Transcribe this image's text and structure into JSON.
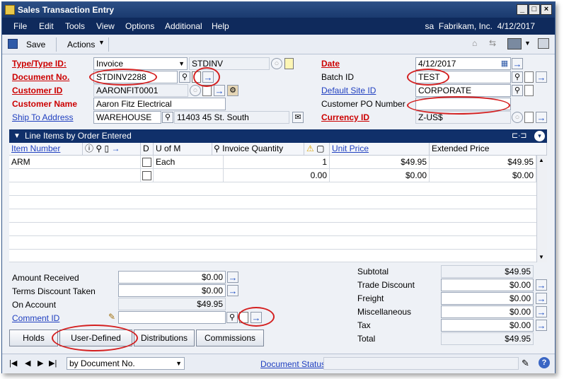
{
  "window": {
    "title": "Sales Transaction Entry"
  },
  "menu": {
    "items": [
      "File",
      "Edit",
      "Tools",
      "View",
      "Options",
      "Additional",
      "Help"
    ],
    "user": "sa",
    "company": "Fabrikam, Inc.",
    "date": "4/12/2017"
  },
  "toolbar": {
    "save": "Save",
    "actions": "Actions"
  },
  "header": {
    "type_label": "Type/Type ID:",
    "type_value": "Invoice",
    "type_id": "STDINV",
    "doc_label": "Document No.",
    "doc_value": "STDINV2288",
    "cust_id_label": "Customer ID",
    "cust_id_value": "AARONFIT0001",
    "cust_name_label": "Customer Name",
    "cust_name_value": "Aaron Fitz Electrical",
    "ship_label": "Ship To Address",
    "ship_value": "WAREHOUSE",
    "ship_addr": "11403 45 St. South",
    "date_label": "Date",
    "date_value": "4/12/2017",
    "batch_label": "Batch ID",
    "batch_value": "TEST",
    "site_label": "Default Site ID",
    "site_value": "CORPORATE",
    "po_label": "Customer PO Number",
    "po_value": "",
    "currency_label": "Currency ID",
    "currency_value": "Z-US$"
  },
  "grid": {
    "title": "Line Items by Order Entered",
    "columns": {
      "item": "Item Number",
      "d": "D",
      "uom": "U of M",
      "qty": "Invoice Quantity",
      "price": "Unit Price",
      "ext": "Extended Price"
    },
    "rows": [
      {
        "item": "ARM",
        "uom": "Each",
        "qty": "1",
        "price": "$49.95",
        "ext": "$49.95"
      },
      {
        "item": "",
        "uom": "",
        "qty": "0.00",
        "price": "$0.00",
        "ext": "$0.00"
      }
    ]
  },
  "left_totals": {
    "amount_received_label": "Amount Received",
    "amount_received": "$0.00",
    "terms_label": "Terms Discount Taken",
    "terms": "$0.00",
    "on_account_label": "On Account",
    "on_account": "$49.95",
    "comment_label": "Comment ID",
    "comment": ""
  },
  "right_totals": {
    "subtotal_label": "Subtotal",
    "subtotal": "$49.95",
    "trade_label": "Trade Discount",
    "trade": "$0.00",
    "freight_label": "Freight",
    "freight": "$0.00",
    "misc_label": "Miscellaneous",
    "misc": "$0.00",
    "tax_label": "Tax",
    "tax": "$0.00",
    "total_label": "Total",
    "total": "$49.95"
  },
  "buttons": {
    "holds": "Holds",
    "user_defined": "User-Defined",
    "distributions": "Distributions",
    "commissions": "Commissions"
  },
  "status": {
    "sort": "by Document No.",
    "doc_status": "Document Status"
  }
}
